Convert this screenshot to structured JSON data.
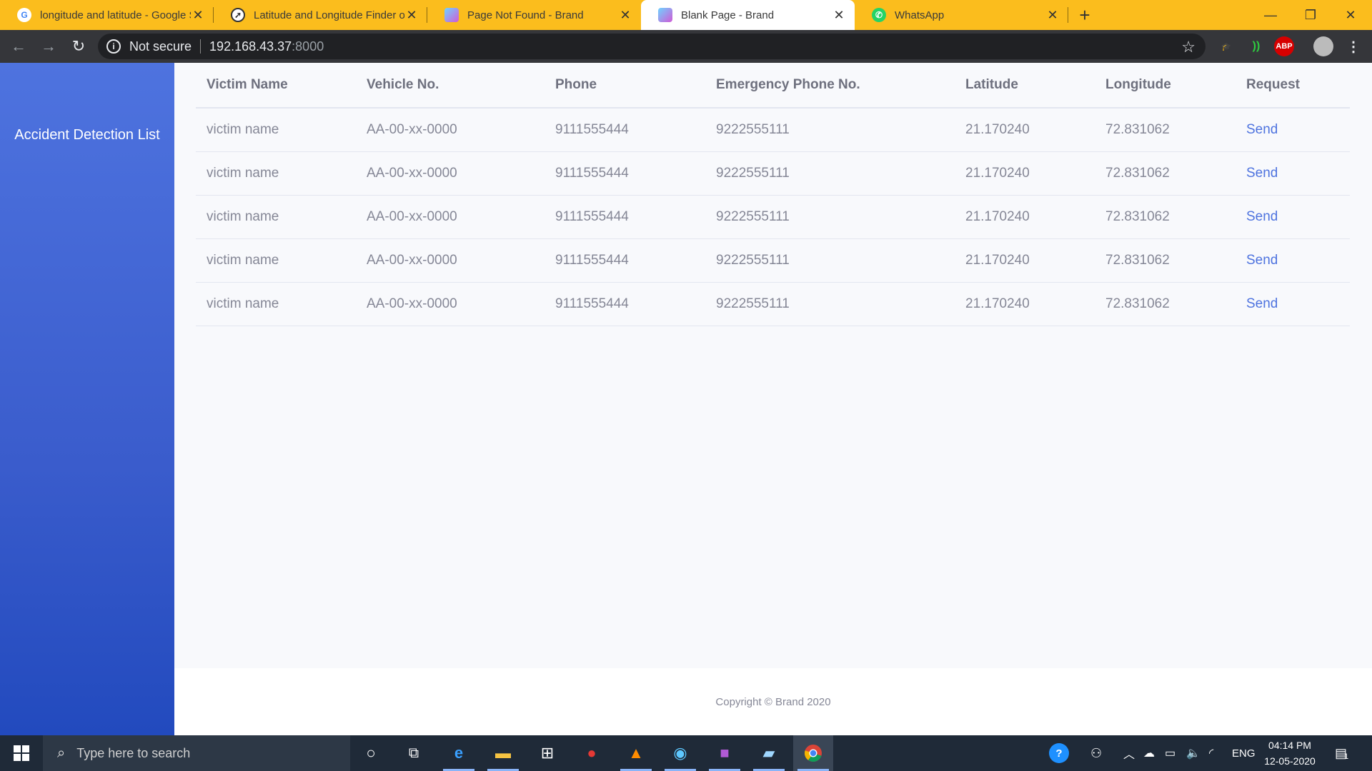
{
  "browser": {
    "tabs": [
      {
        "title": "longitude and latitude - Google Se",
        "favicon": "google-icon"
      },
      {
        "title": "Latitude and Longitude Finder on",
        "favicon": "compass-icon"
      },
      {
        "title": "Page Not Found - Brand",
        "favicon": "brand-cube-icon"
      },
      {
        "title": "Blank Page - Brand",
        "favicon": "brand-cube-icon",
        "active": true
      },
      {
        "title": "WhatsApp",
        "favicon": "whatsapp-icon"
      }
    ],
    "address": {
      "security": "Not secure",
      "host": "192.168.43.37",
      "port": ":8000"
    }
  },
  "sidebar": {
    "brand": "Accident Detection List"
  },
  "table": {
    "headers": [
      "Victim Name",
      "Vehicle No.",
      "Phone",
      "Emergency Phone No.",
      "Latitude",
      "Longitude",
      "Request"
    ],
    "rows": [
      [
        "victim name",
        "AA-00-xx-0000",
        "9111555444",
        "9222555111",
        "21.170240",
        "72.831062",
        "Send"
      ],
      [
        "victim name",
        "AA-00-xx-0000",
        "9111555444",
        "9222555111",
        "21.170240",
        "72.831062",
        "Send"
      ],
      [
        "victim name",
        "AA-00-xx-0000",
        "9111555444",
        "9222555111",
        "21.170240",
        "72.831062",
        "Send"
      ],
      [
        "victim name",
        "AA-00-xx-0000",
        "9111555444",
        "9222555111",
        "21.170240",
        "72.831062",
        "Send"
      ],
      [
        "victim name",
        "AA-00-xx-0000",
        "9111555444",
        "9222555111",
        "21.170240",
        "72.831062",
        "Send"
      ]
    ]
  },
  "footer": {
    "copyright": "Copyright © Brand 2020"
  },
  "taskbar": {
    "search_placeholder": "Type here to search",
    "language": "ENG",
    "time": "04:14 PM",
    "date": "12-05-2020",
    "notifications": "1"
  },
  "colors": {
    "tabbar": "#fbbd1d",
    "sidebar": "#4e73df",
    "link": "#4e73df",
    "taskbar": "#1f2a38"
  }
}
